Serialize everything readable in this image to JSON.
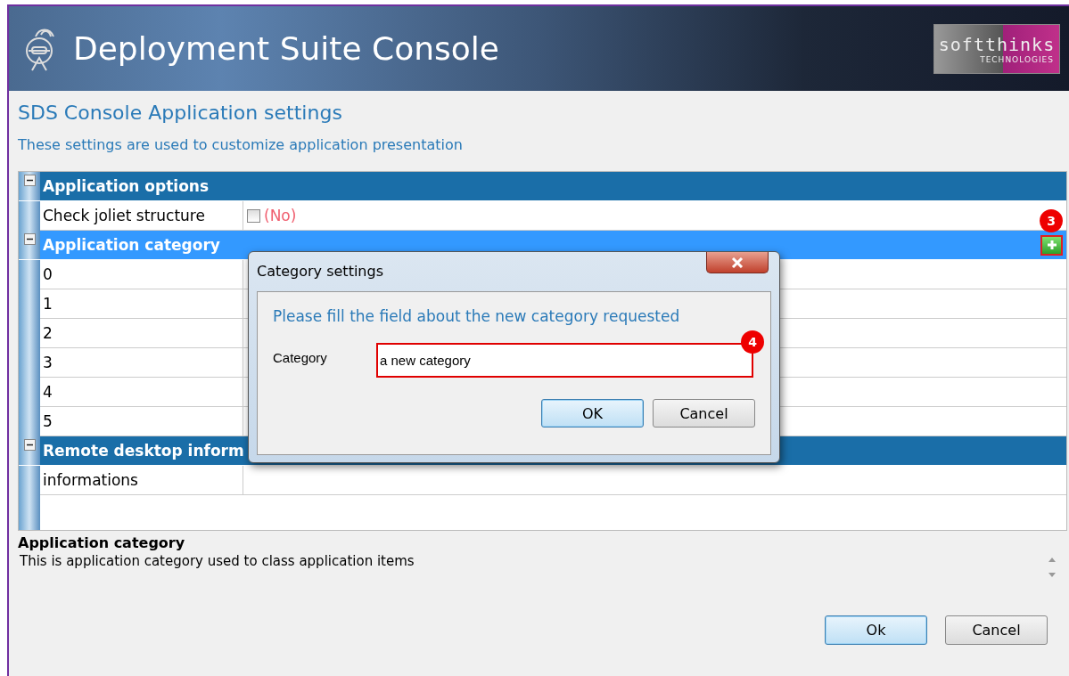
{
  "window": {
    "title": "Deployment Suite Console",
    "logo": {
      "text": "softthinks",
      "tagline": "TECHNOLOGIES"
    }
  },
  "page": {
    "heading": "SDS Console Application settings",
    "subtitle": "These settings are used to customize application presentation"
  },
  "property_grid": {
    "sections": [
      {
        "title": "Application options",
        "expanded": true,
        "selected": false,
        "rows": [
          {
            "kind": "checkbox",
            "name": "Check joliet structure",
            "checked": false,
            "value": "(No)"
          }
        ]
      },
      {
        "title": "Application category",
        "expanded": true,
        "selected": true,
        "add_button": {
          "badge": "3"
        },
        "rows": [
          {
            "kind": "text",
            "name": "0"
          },
          {
            "kind": "text",
            "name": "1"
          },
          {
            "kind": "text",
            "name": "2"
          },
          {
            "kind": "text",
            "name": "3"
          },
          {
            "kind": "text",
            "name": "4"
          },
          {
            "kind": "text",
            "name": "5"
          }
        ]
      },
      {
        "title": "Remote desktop inform",
        "expanded": true,
        "selected": false,
        "rows": [
          {
            "kind": "text",
            "name": "informations"
          }
        ]
      }
    ]
  },
  "description": {
    "title": "Application category",
    "text": "This is application category used to class application items"
  },
  "buttons": [
    {
      "label": "Ok",
      "default": true
    },
    {
      "label": "Cancel",
      "default": false
    }
  ],
  "dialog": {
    "title": "Category settings",
    "message": "Please fill the field about the new category requested",
    "field_label": "Category",
    "field_value": "a new category",
    "badge": "4",
    "buttons": [
      {
        "label": "OK",
        "default": true
      },
      {
        "label": "Cancel",
        "default": false
      }
    ]
  }
}
